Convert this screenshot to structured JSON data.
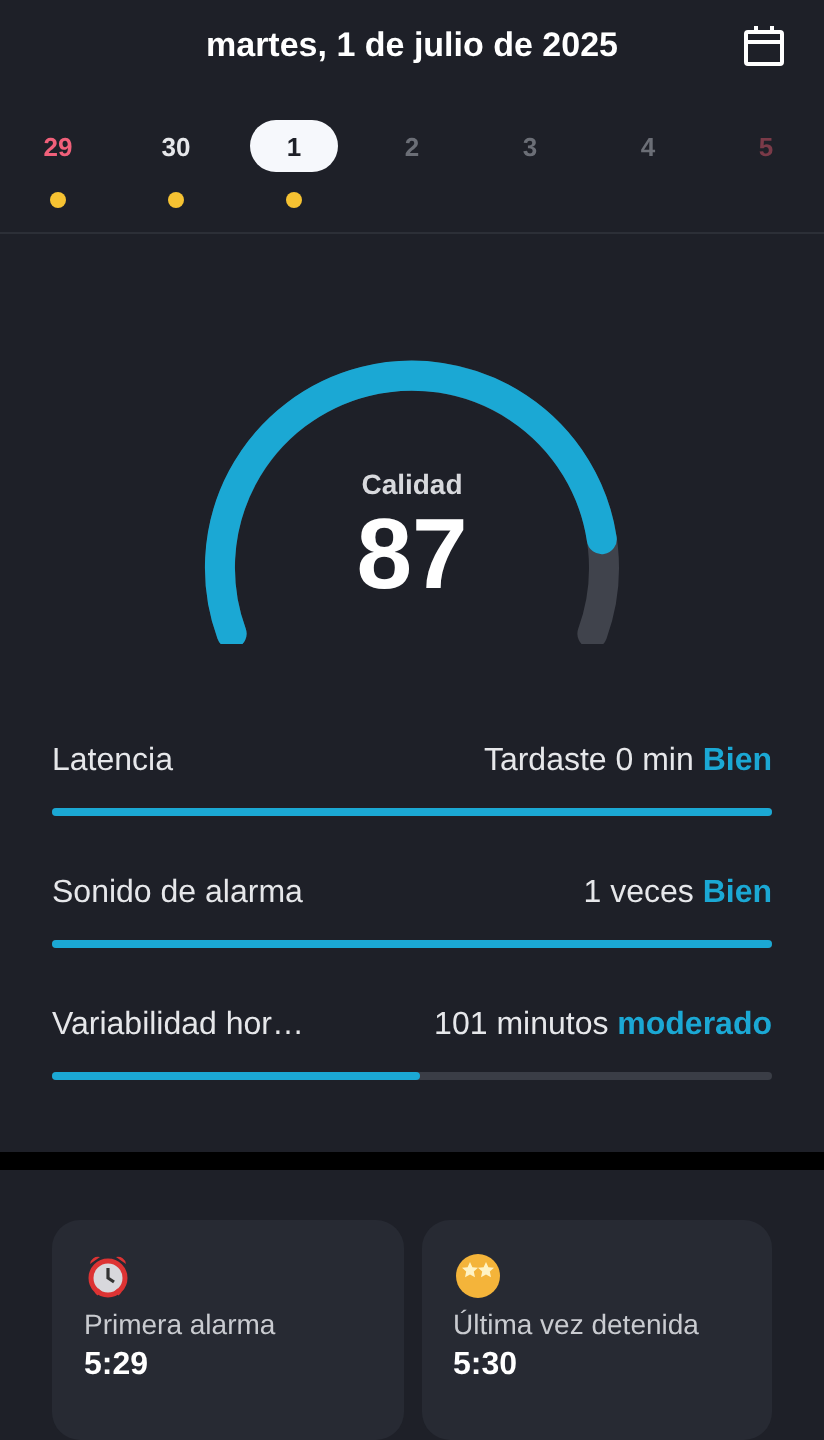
{
  "header": {
    "title": "martes, 1 de julio de 2025"
  },
  "days": [
    {
      "label": "29",
      "selected": false,
      "color": "#f0607a",
      "marked": true
    },
    {
      "label": "30",
      "selected": false,
      "color": "#e6e7ea",
      "marked": true
    },
    {
      "label": "1",
      "selected": true,
      "color": "#1e2028",
      "marked": true
    },
    {
      "label": "2",
      "selected": false,
      "color": "#6b6e76",
      "marked": false
    },
    {
      "label": "3",
      "selected": false,
      "color": "#6b6e76",
      "marked": false
    },
    {
      "label": "4",
      "selected": false,
      "color": "#6b6e76",
      "marked": false
    },
    {
      "label": "5",
      "selected": false,
      "color": "#7a3a48",
      "marked": false
    }
  ],
  "score": {
    "label": "Calidad",
    "value": "87"
  },
  "metrics": [
    {
      "name": "Latencia",
      "reading": "Tardaste 0 min",
      "rating": "Bien",
      "level": 1
    },
    {
      "name": "Sonido de alarma",
      "reading": "1 veces",
      "rating": "Bien",
      "level": 1
    },
    {
      "name": "Variabilidad hor…",
      "reading": "101 minutos",
      "rating": "moderado",
      "level": 0.51
    }
  ],
  "cards": [
    {
      "kind": "alarm",
      "label": "Primera alarma",
      "time": "5:29"
    },
    {
      "kind": "star",
      "label": "Última vez detenida",
      "time": "5:30"
    }
  ]
}
